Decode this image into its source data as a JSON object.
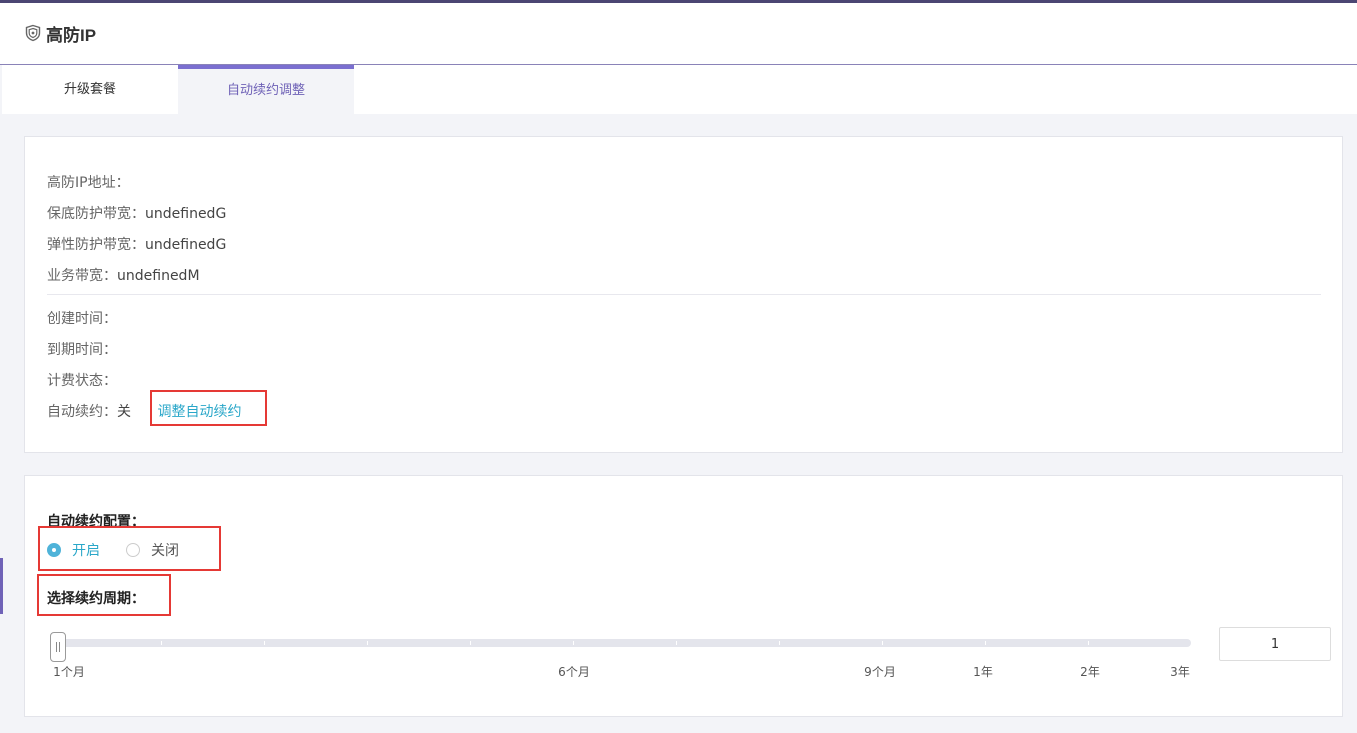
{
  "header": {
    "title": "高防IP",
    "icon": "shield-icon"
  },
  "tabs": [
    {
      "label": "升级套餐",
      "active": false
    },
    {
      "label": "自动续约调整",
      "active": true
    }
  ],
  "info": {
    "ip_label": "高防IP地址：",
    "ip_value": "",
    "base_bw_label": "保底防护带宽：",
    "base_bw_value": "undefinedG",
    "elastic_bw_label": "弹性防护带宽：",
    "elastic_bw_value": "undefinedG",
    "biz_bw_label": "业务带宽：",
    "biz_bw_value": "undefinedM",
    "created_label": "创建时间：",
    "created_value": "",
    "expire_label": "到期时间：",
    "expire_value": "",
    "billing_label": "计费状态：",
    "billing_value": "",
    "auto_renew_label": "自动续约：",
    "auto_renew_value": "关",
    "adjust_link": "调整自动续约"
  },
  "config": {
    "title": "自动续约配置：",
    "options": [
      {
        "label": "开启",
        "selected": true
      },
      {
        "label": "关闭",
        "selected": false
      }
    ],
    "period_title": "选择续约周期：",
    "period_value": "1",
    "slider_labels": [
      "1个月",
      "6个月",
      "9个月",
      "1年",
      "2年",
      "3年"
    ]
  },
  "colors": {
    "accent": "#6f62b7",
    "link": "#2aa7c9",
    "highlight": "#e53935",
    "topbar": "#4b4673"
  }
}
